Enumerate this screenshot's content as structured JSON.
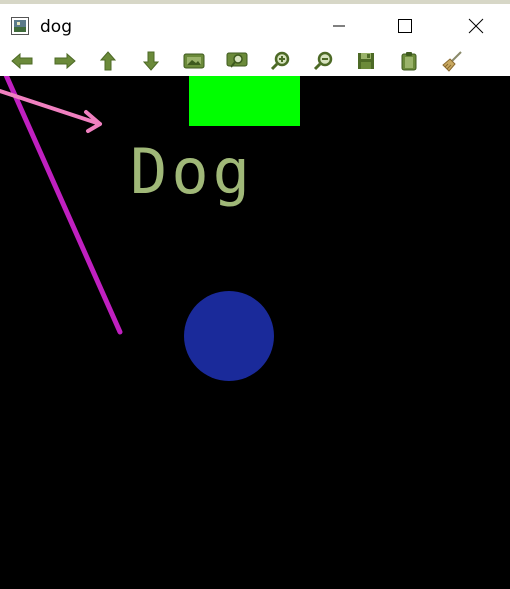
{
  "window": {
    "title": "dog",
    "controls": [
      "minimize",
      "maximize",
      "close"
    ]
  },
  "toolbar": {
    "tools": [
      {
        "name": "pan-left-icon"
      },
      {
        "name": "pan-right-icon"
      },
      {
        "name": "pan-up-icon"
      },
      {
        "name": "pan-down-icon"
      },
      {
        "name": "zoom-fit-icon"
      },
      {
        "name": "zoom-region-icon"
      },
      {
        "name": "zoom-in-icon"
      },
      {
        "name": "zoom-out-icon"
      },
      {
        "name": "save-icon"
      },
      {
        "name": "copy-clipboard-icon"
      },
      {
        "name": "clear-brush-icon"
      }
    ]
  },
  "canvas": {
    "label": "Dog",
    "colors": {
      "rectangle": "#00ff00",
      "text": "#a0b878",
      "circle": "#1a2a9a",
      "magenta_line": "#c020c0",
      "pink_arrow": "#f080c0"
    }
  }
}
